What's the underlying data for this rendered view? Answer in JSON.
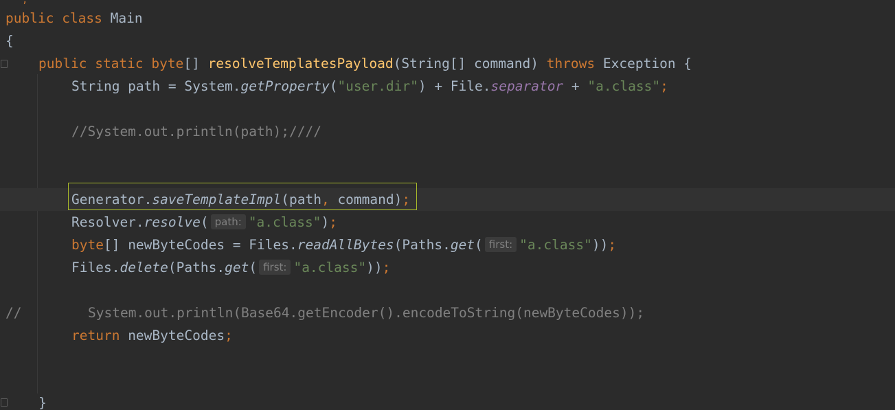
{
  "editor": {
    "top_fragment": ";",
    "lines": {
      "class_decl": {
        "kw1": "public",
        "kw2": "class",
        "name": "Main"
      },
      "open_brace": "{",
      "method_decl": {
        "kw_public": "public",
        "kw_static": "static",
        "kw_byte": "byte",
        "arr": "[] ",
        "method": "resolveTemplatesPayload",
        "params": "(String[] command) ",
        "kw_throws": "throws",
        "rest": " Exception {"
      },
      "path_line": {
        "a": "String path = System.",
        "getProperty": "getProperty",
        "b": "(",
        "s1": "\"user.dir\"",
        "c": ") + File.",
        "separator": "separator",
        "d": " + ",
        "s2": "\"a.class\"",
        "semi": ";"
      },
      "comment1": "//System.out.println(path);////",
      "generator_line": {
        "a": "Generator.",
        "method": "saveTemplateImpl",
        "b": "(path",
        "comma": ",",
        "c": " command)",
        "semi": ";"
      },
      "resolver_line": {
        "a": "Resolver.",
        "method": "resolve",
        "b": "(",
        "hint": "path:",
        "s": "\"a.class\"",
        "c": ")",
        "semi": ";"
      },
      "bytes_line": {
        "kw": "byte",
        "a": "[] newByteCodes = Files.",
        "method": "readAllBytes",
        "b": "(Paths.",
        "get": "get",
        "c": "(",
        "hint": "first:",
        "s": "\"a.class\"",
        "d": "))",
        "semi": ";"
      },
      "delete_line": {
        "a": "Files.",
        "method": "delete",
        "b": "(Paths.",
        "get": "get",
        "c": "(",
        "hint": "first:",
        "s": "\"a.class\"",
        "d": "))",
        "semi": ";"
      },
      "comment2": {
        "slashes": "//",
        "text": "System.out.println(Base64.getEncoder().encodeToString(newByteCodes));"
      },
      "return_line": {
        "kw": "return",
        "rest": " newByteCodes",
        "semi": ";"
      },
      "close_brace": "}"
    }
  },
  "colors": {
    "background": "#2b2b2b",
    "keyword": "#cc7832",
    "method_decl": "#ffc66d",
    "string": "#6a8759",
    "static_field": "#9876aa",
    "comment": "#808080",
    "default_text": "#a9b7c6",
    "highlight_border": "#a8b92a"
  }
}
